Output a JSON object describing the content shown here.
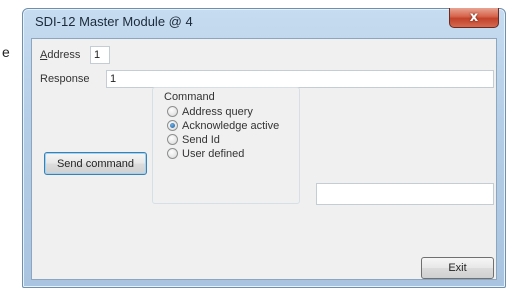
{
  "background": {
    "partial_letter": "e"
  },
  "window": {
    "title": "SDI-12 Master Module @ 4",
    "close_icon_glyph": "x"
  },
  "form": {
    "address_label_accel": "A",
    "address_label_rest": "ddress",
    "address_value": "1",
    "response_label": "Response",
    "response_value": "1",
    "send_button_label": "Send command",
    "exit_button_label": "Exit",
    "user_defined_value": ""
  },
  "command_group": {
    "title": "Command",
    "options": [
      {
        "label": "Address query",
        "checked": false
      },
      {
        "label": "Acknowledge active",
        "checked": true
      },
      {
        "label": "Send Id",
        "checked": false
      },
      {
        "label": "User defined",
        "checked": false
      }
    ]
  },
  "colors": {
    "title_bar": "#b5cee7",
    "close_button": "#c2422a",
    "client_area": "#f0f0f0",
    "default_button_border": "#3c7fb1"
  },
  "icons": [
    "close-icon",
    "radio-icon"
  ]
}
